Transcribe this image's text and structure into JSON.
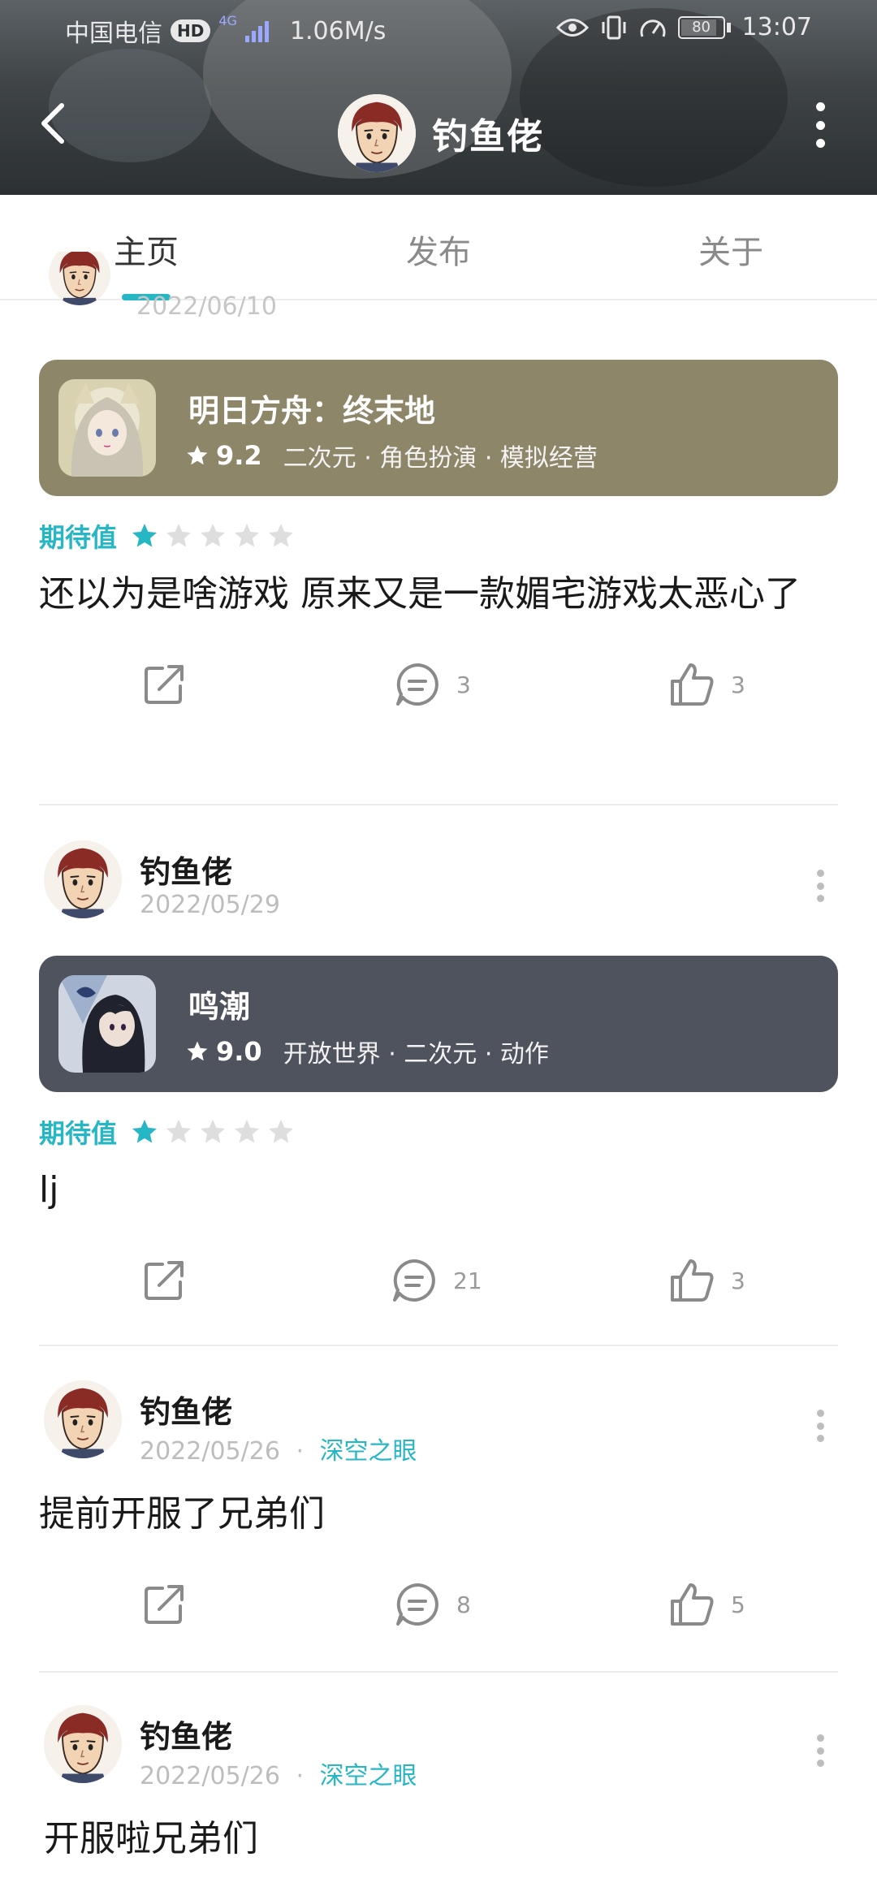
{
  "status_bar": {
    "carrier": "中国电信",
    "hd": "HD",
    "network": "4G",
    "speed": "1.06M/s",
    "battery": "80",
    "time": "13:07"
  },
  "header": {
    "title": "钓鱼佬"
  },
  "tabs": [
    {
      "label": "主页",
      "active": true
    },
    {
      "label": "发布",
      "active": false
    },
    {
      "label": "关于",
      "active": false
    }
  ],
  "colors": {
    "accent": "#27b6c4",
    "card1": "#8d8669",
    "card2": "#4f535d"
  },
  "partial_post": {
    "date": "2022/06/10"
  },
  "posts": [
    {
      "game": {
        "name": "明日方舟：终末地",
        "score": "9.2",
        "tags": "二次元 · 角色扮演 · 模拟经营"
      },
      "rating_label": "期待值",
      "rating": 1,
      "text": "还以为是啥游戏 原来又是一款媚宅游戏太恶心了",
      "comments": "3",
      "likes": "3"
    },
    {
      "user": "钓鱼佬",
      "date": "2022/05/29",
      "game": {
        "name": "鸣潮",
        "score": "9.0",
        "tags": "开放世界 · 二次元 · 动作"
      },
      "rating_label": "期待值",
      "rating": 1,
      "text": "lj",
      "comments": "21",
      "likes": "3"
    },
    {
      "user": "钓鱼佬",
      "date": "2022/05/26",
      "separator": "·",
      "tag": "深空之眼",
      "text": "提前开服了兄弟们",
      "comments": "8",
      "likes": "5"
    },
    {
      "user": "钓鱼佬",
      "date": "2022/05/26",
      "separator": "·",
      "tag": "深空之眼",
      "text": "开服啦兄弟们"
    }
  ]
}
